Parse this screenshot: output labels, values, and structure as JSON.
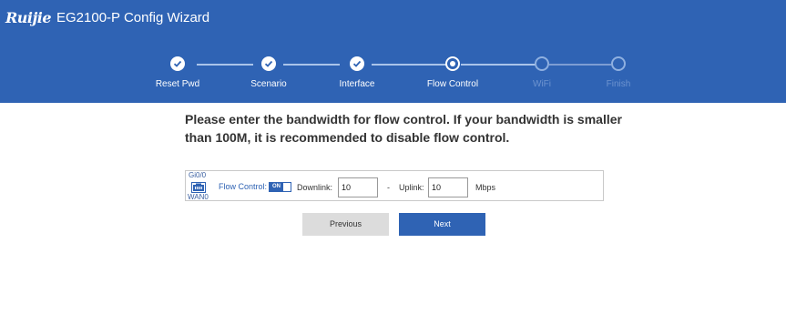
{
  "header": {
    "brand": "Ruijie",
    "title": "EG2100-P  Config Wizard"
  },
  "steps": [
    {
      "label": "Reset Pwd",
      "state": "done"
    },
    {
      "label": "Scenario",
      "state": "done"
    },
    {
      "label": "Interface",
      "state": "done"
    },
    {
      "label": "Flow Control",
      "state": "current"
    },
    {
      "label": "WiFi",
      "state": "pending"
    },
    {
      "label": "Finish",
      "state": "pending"
    }
  ],
  "instruction": "Please enter the bandwidth for flow control. If your bandwidth is smaller than 100M, it is recommended to disable flow control.",
  "panel": {
    "port_name": "Gi0/0",
    "port_role": "WAN0",
    "flow_control_label": "Flow Control:",
    "toggle_text": "ON",
    "downlink_label": "Downlink:",
    "downlink_value": "10",
    "dash": "-",
    "uplink_label": "Uplink:",
    "uplink_value": "10",
    "unit": "Mbps"
  },
  "buttons": {
    "previous": "Previous",
    "next": "Next"
  },
  "colors": {
    "header_bg": "#2f63b4",
    "primary_button": "#2f63b4",
    "secondary_button": "#dcdcdc"
  }
}
